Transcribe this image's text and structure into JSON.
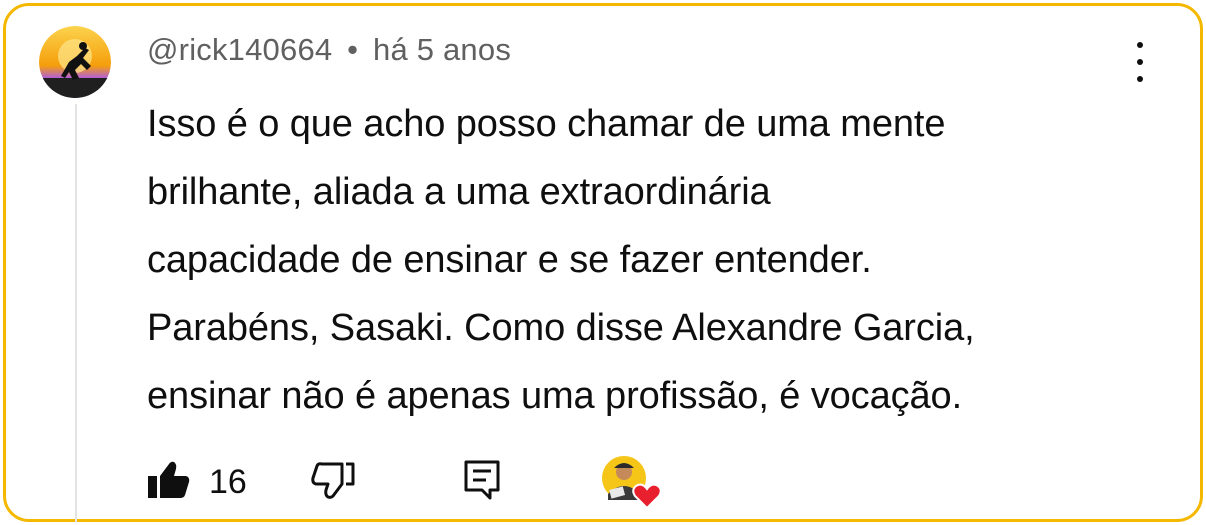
{
  "comment": {
    "author": "@rick140664",
    "separator": "•",
    "time": "há 5 anos",
    "text_lines": [
      "Isso é o que acho posso chamar de uma mente",
      "brilhante, aliada a uma extraordinária",
      "capacidade de ensinar e se fazer entender.",
      "Parabéns, Sasaki. Como disse Alexandre Garcia,",
      "ensinar não é apenas uma profissão, é vocação."
    ],
    "likes": "16"
  },
  "icons": {
    "like": "thumbs-up-filled-icon",
    "dislike": "thumbs-down-outline-icon",
    "reply": "reply-comment-icon",
    "menu": "more-vertical-icon",
    "heart": "heart-icon"
  },
  "colors": {
    "border": "#f5b800",
    "text": "#0f0f0f",
    "meta": "#606060",
    "heart": "#e8202e"
  }
}
